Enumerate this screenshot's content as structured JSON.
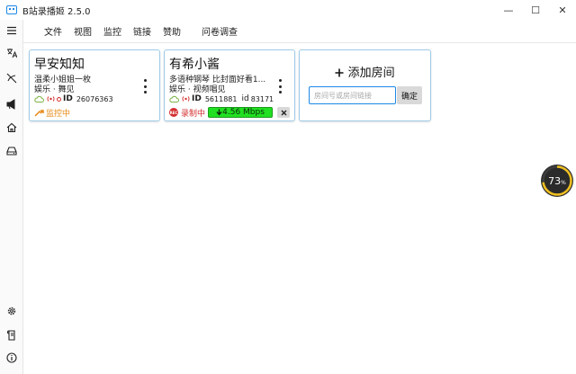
{
  "window": {
    "title": "B站录播姬 2.5.0",
    "controls": {
      "minimize": "—",
      "maximize": "☐",
      "close": "✕"
    }
  },
  "menu": [
    "文件",
    "视图",
    "监控",
    "链接",
    "赞助",
    "问卷调查"
  ],
  "sidebar": {
    "top": [
      "menu-icon",
      "translate-icon",
      "slash-icon",
      "announce-icon",
      "home-icon",
      "storage-icon"
    ],
    "bottom": [
      "gear-icon",
      "log-icon",
      "info-icon"
    ]
  },
  "rooms": [
    {
      "streamer": "早安知知",
      "stream_title": "温柔小姐姐一枚",
      "category": "娱乐 · 舞见",
      "id_label": "ID",
      "room_id": "26076363",
      "status": "监控中"
    },
    {
      "streamer": "有希小酱",
      "stream_title": "多语种钢琴 比封面好看1...",
      "category": "娱乐 · 视频唱见",
      "id_label": "ID",
      "room_id": "5611881",
      "short_id_label": "id",
      "short_id": "83171",
      "rec_badge": "REC",
      "status": "录制中",
      "speed": "4.56 Mbps"
    }
  ],
  "add_room": {
    "title": "添加房间",
    "placeholder": "房间号或房间链接",
    "confirm": "确定"
  },
  "gauge": {
    "value": "73",
    "unit": "%",
    "percent": 73,
    "ring_color": "#f0c020"
  },
  "colors": {
    "accent": "#1e88e5",
    "monitoring": "#e88a16",
    "recording": "#d32f2f",
    "speed_bg": "#21e021"
  }
}
